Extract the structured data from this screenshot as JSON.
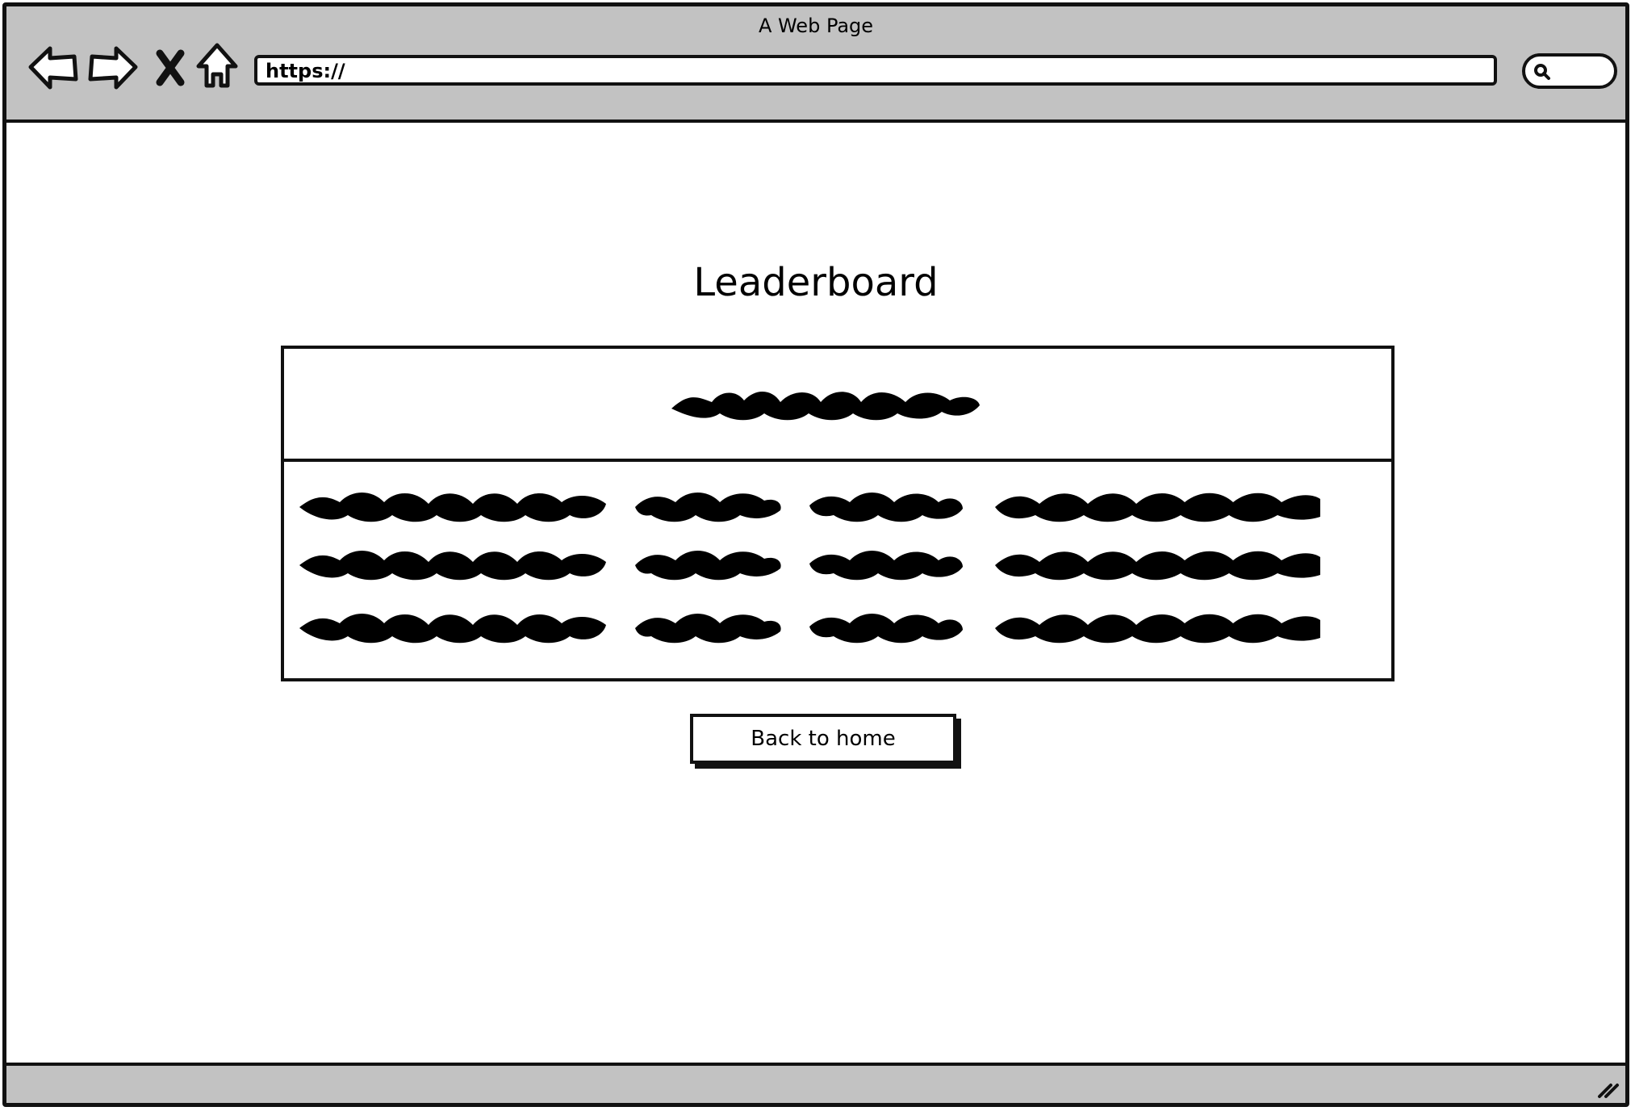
{
  "browser": {
    "window_title": "A Web Page",
    "url": "https://",
    "icons": [
      "back-arrow-icon",
      "forward-arrow-icon",
      "close-icon",
      "home-icon",
      "search-icon",
      "resize-grip-icon"
    ]
  },
  "page": {
    "title": "Leaderboard",
    "back_button_label": "Back to home"
  },
  "leaderboard": {
    "columns": 4,
    "rows": 3,
    "header_placeholder": "squiggle",
    "cell_placeholder": "squiggle"
  },
  "colors": {
    "chrome": "#c2c2c2",
    "ink": "#111111",
    "background": "#ffffff"
  }
}
